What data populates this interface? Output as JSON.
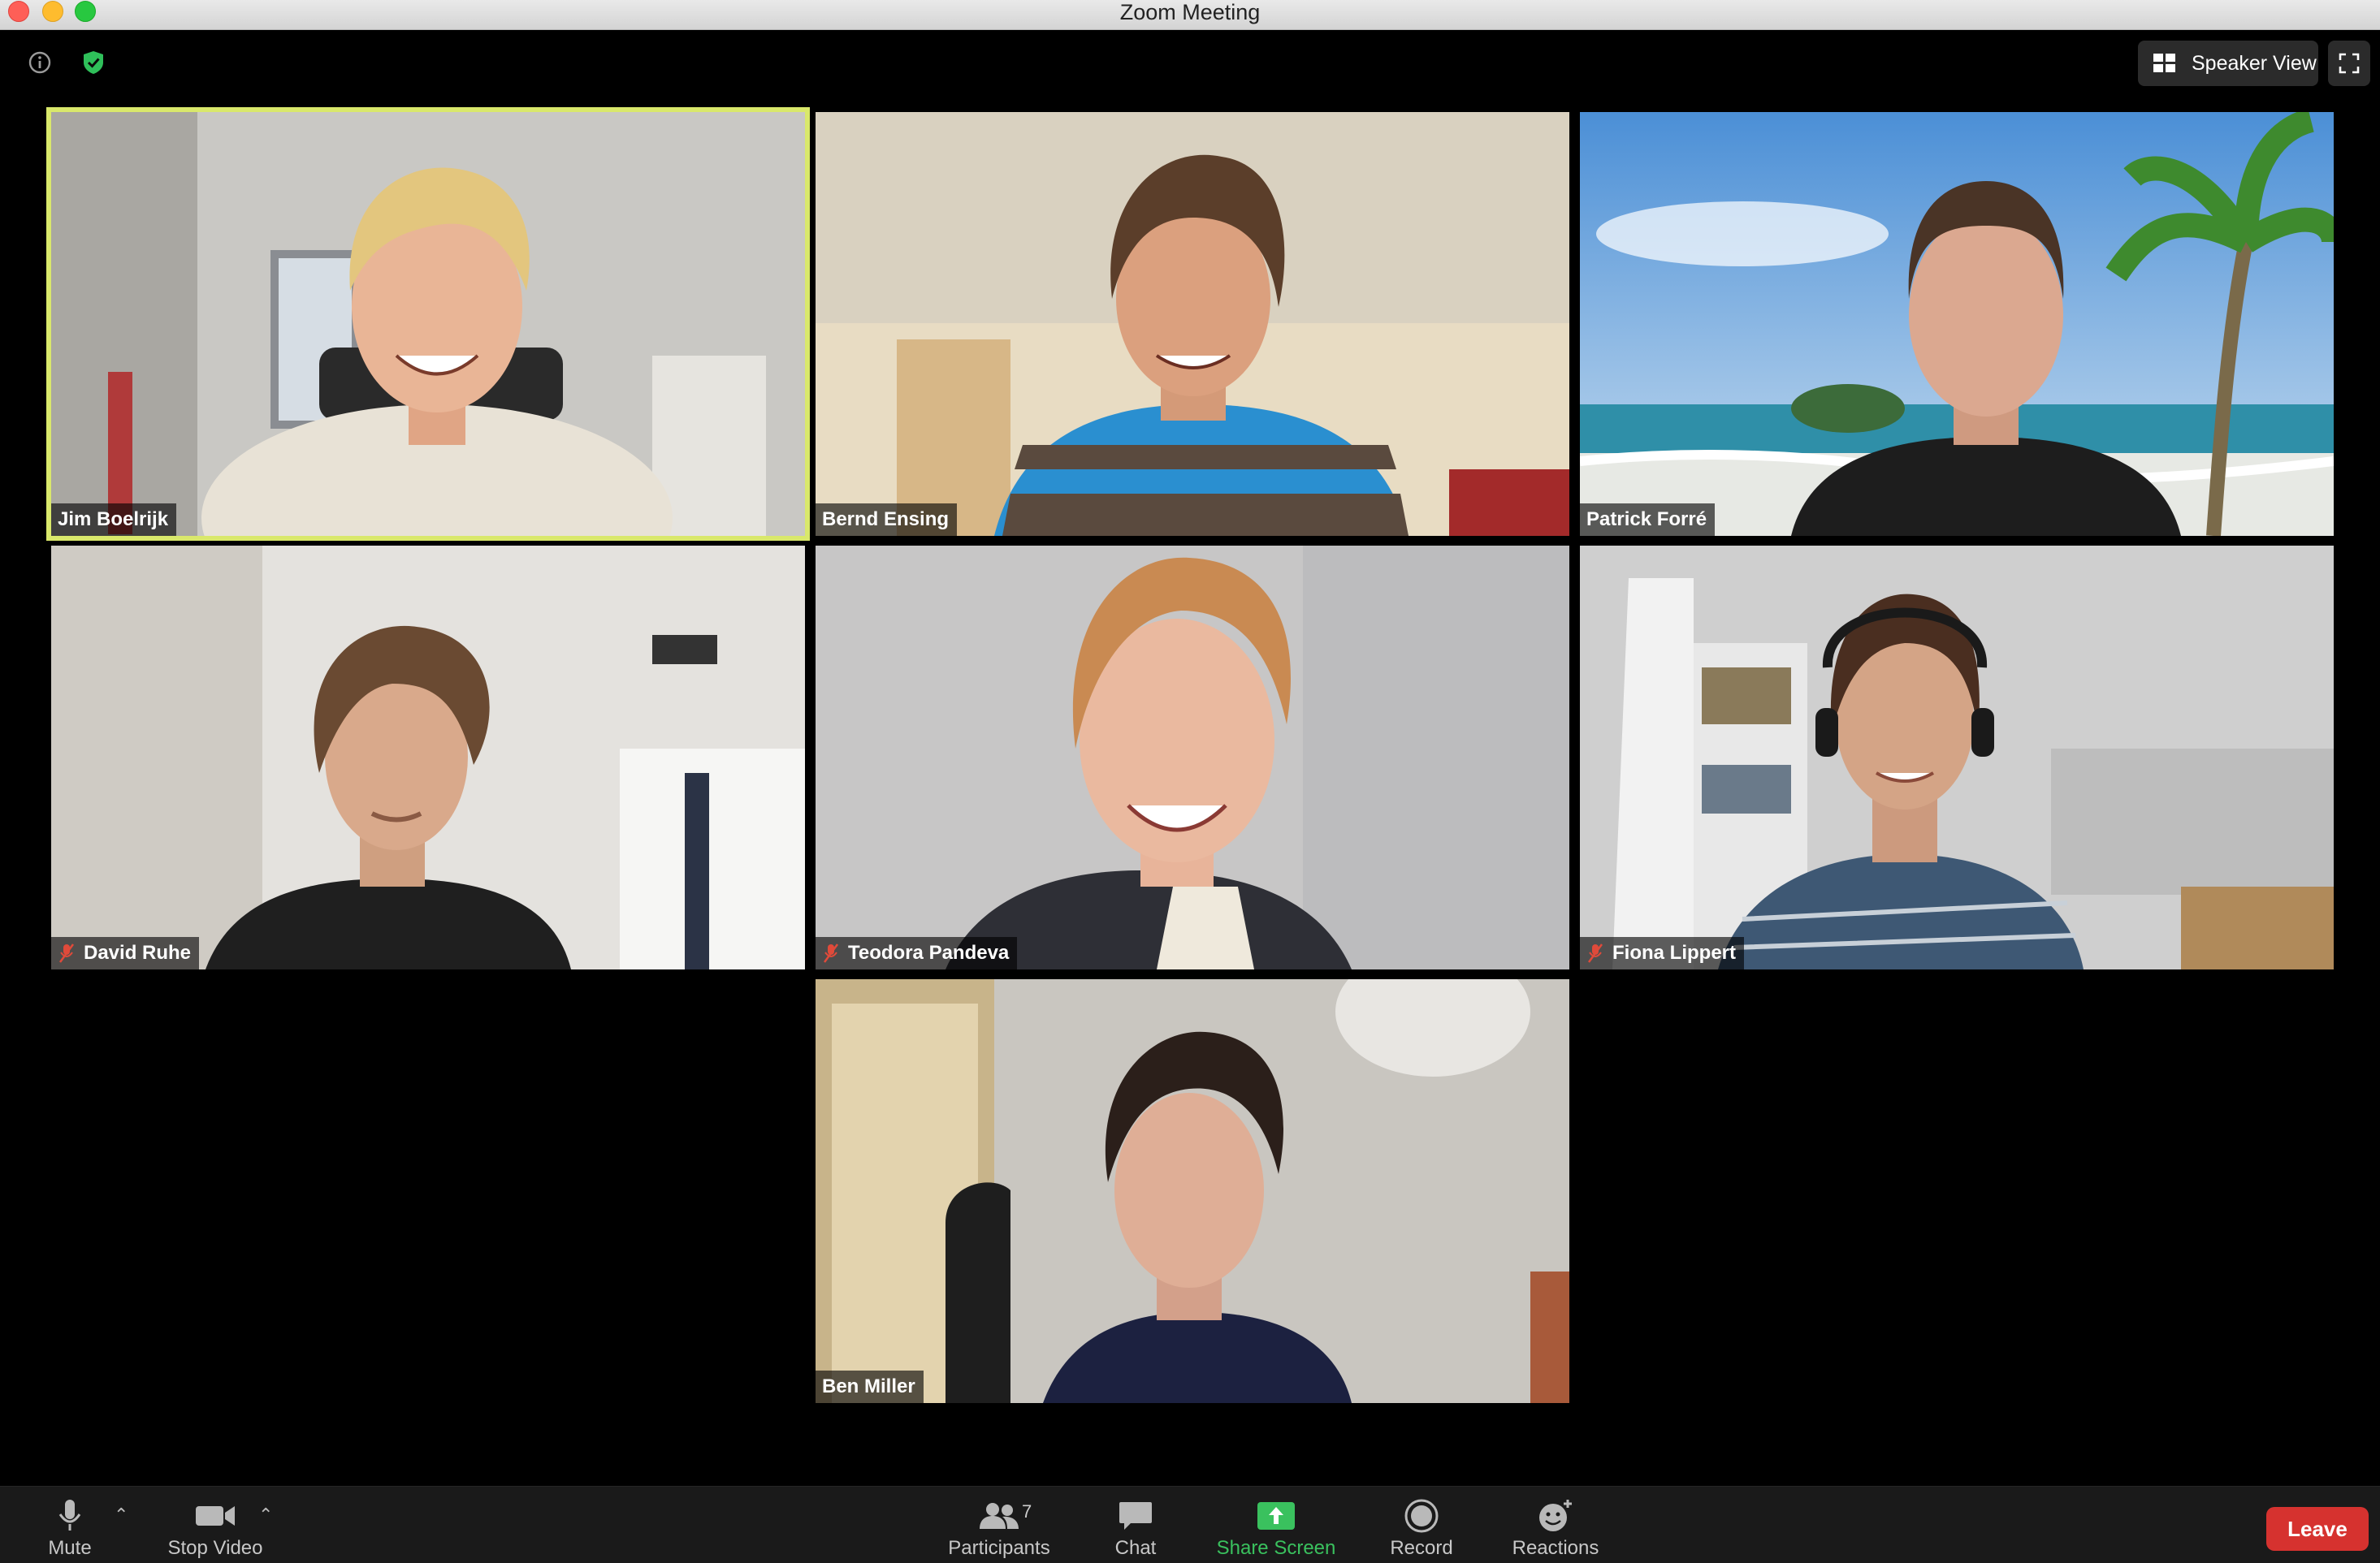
{
  "window": {
    "title": "Zoom Meeting"
  },
  "top_bar": {
    "info_icon": "info-icon",
    "security_icon": "shield-check-icon",
    "speaker_view_label": "Speaker View",
    "fullscreen_icon": "fullscreen-icon"
  },
  "participants": [
    {
      "name": "Jim Boelrijk",
      "muted": false,
      "active_speaker": true
    },
    {
      "name": "Bernd Ensing",
      "muted": false,
      "active_speaker": false
    },
    {
      "name": "Patrick Forré",
      "muted": false,
      "active_speaker": false
    },
    {
      "name": "David Ruhe",
      "muted": true,
      "active_speaker": false
    },
    {
      "name": "Teodora Pandeva",
      "muted": true,
      "active_speaker": false
    },
    {
      "name": "Fiona Lippert",
      "muted": true,
      "active_speaker": false
    },
    {
      "name": "Ben Miller",
      "muted": false,
      "active_speaker": false
    }
  ],
  "toolbar": {
    "mute_label": "Mute",
    "stop_video_label": "Stop Video",
    "participants_label": "Participants",
    "participants_count": "7",
    "chat_label": "Chat",
    "share_screen_label": "Share Screen",
    "record_label": "Record",
    "reactions_label": "Reactions",
    "leave_label": "Leave"
  },
  "colors": {
    "active_speaker_border": "#d9e86b",
    "share_screen_green": "#3ac15e",
    "leave_red": "#d6322f"
  }
}
